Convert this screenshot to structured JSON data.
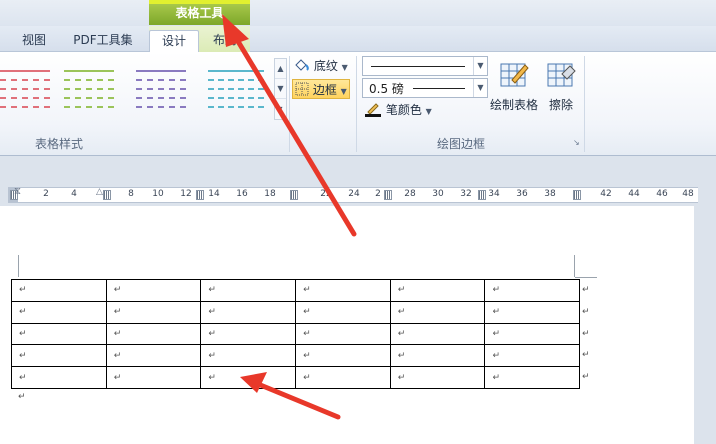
{
  "contextual_tab": {
    "label": "表格工具",
    "color": "#8db43a"
  },
  "tabs": [
    {
      "label": "视图"
    },
    {
      "label": "PDF工具集"
    },
    {
      "label": "设计"
    },
    {
      "label": "布局"
    }
  ],
  "ribbon": {
    "table_styles": {
      "group_label": "表格样式",
      "thumb_colors": [
        "#e0707a",
        "#9bc45a",
        "#8a7ac0",
        "#5ab7cc"
      ]
    },
    "shading_button": {
      "label": "底纹",
      "icon": "paint-bucket-icon"
    },
    "borders_button": {
      "label": "边框",
      "icon": "borders-icon"
    },
    "line_weight": {
      "label": "0.5 磅"
    },
    "pen_color": {
      "label": "笔颜色",
      "icon": "pen-icon"
    },
    "draw_table": {
      "label": "绘制表格",
      "icon": "draw-table-icon"
    },
    "eraser": {
      "label": "擦除",
      "icon": "eraser-icon"
    },
    "draw_borders_group_label": "绘图边框"
  },
  "ruler": {
    "numbers": [
      "2",
      "4",
      "8",
      "10",
      "12",
      "14",
      "16",
      "18",
      "22",
      "24",
      "2",
      "28",
      "30",
      "32",
      "34",
      "36",
      "38",
      "42",
      "44",
      "46",
      "48"
    ]
  },
  "table": {
    "rows": 5,
    "cols": 6,
    "cell_mark": "↵"
  },
  "after_table_mark": "↵"
}
